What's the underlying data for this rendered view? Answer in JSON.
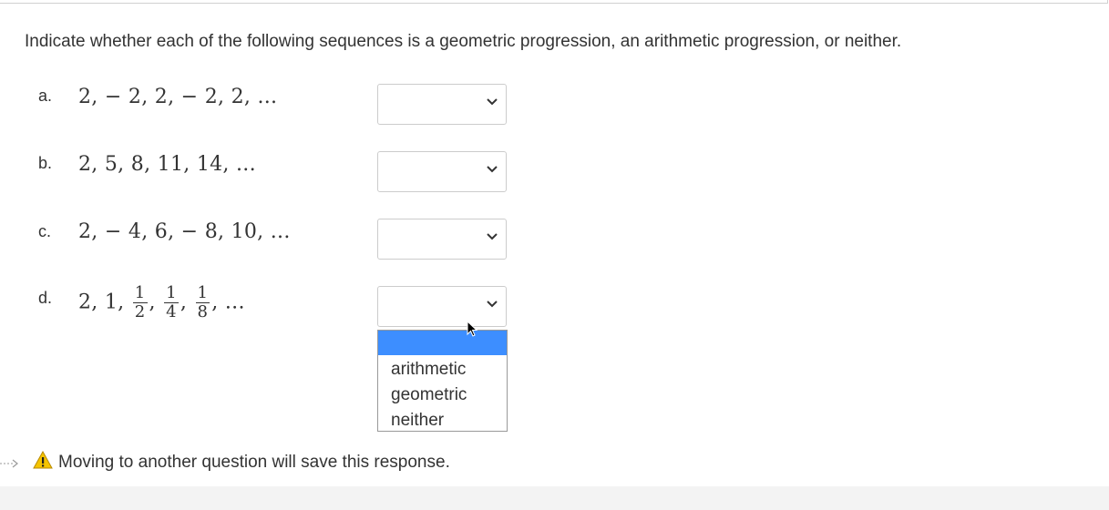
{
  "instruction": "Indicate whether each of the following sequences is a geometric progression, an arithmetic progression, or neither.",
  "questions": [
    {
      "label": "a.",
      "sequence": "2, − 2, 2, − 2, 2, ..."
    },
    {
      "label": "b.",
      "sequence": "2, 5, 8, 11, 14, ..."
    },
    {
      "label": "c.",
      "sequence": "2, − 4, 6, − 8, 10, ..."
    },
    {
      "label": "d.",
      "sequence_prefix": "2, 1, ",
      "fractions": [
        {
          "num": "1",
          "den": "2"
        },
        {
          "num": "1",
          "den": "4"
        },
        {
          "num": "1",
          "den": "8"
        }
      ],
      "sequence_suffix": "..."
    }
  ],
  "dropdown": {
    "options": [
      "",
      "arithmetic",
      "geometric",
      "neither"
    ],
    "highlighted_index": 0,
    "highlight_color": "#3d8eff"
  },
  "save_note": "Moving to another question will save this response.",
  "icons": {
    "warning": "warning-triangle-icon",
    "chevron": "chevron-down-icon"
  }
}
